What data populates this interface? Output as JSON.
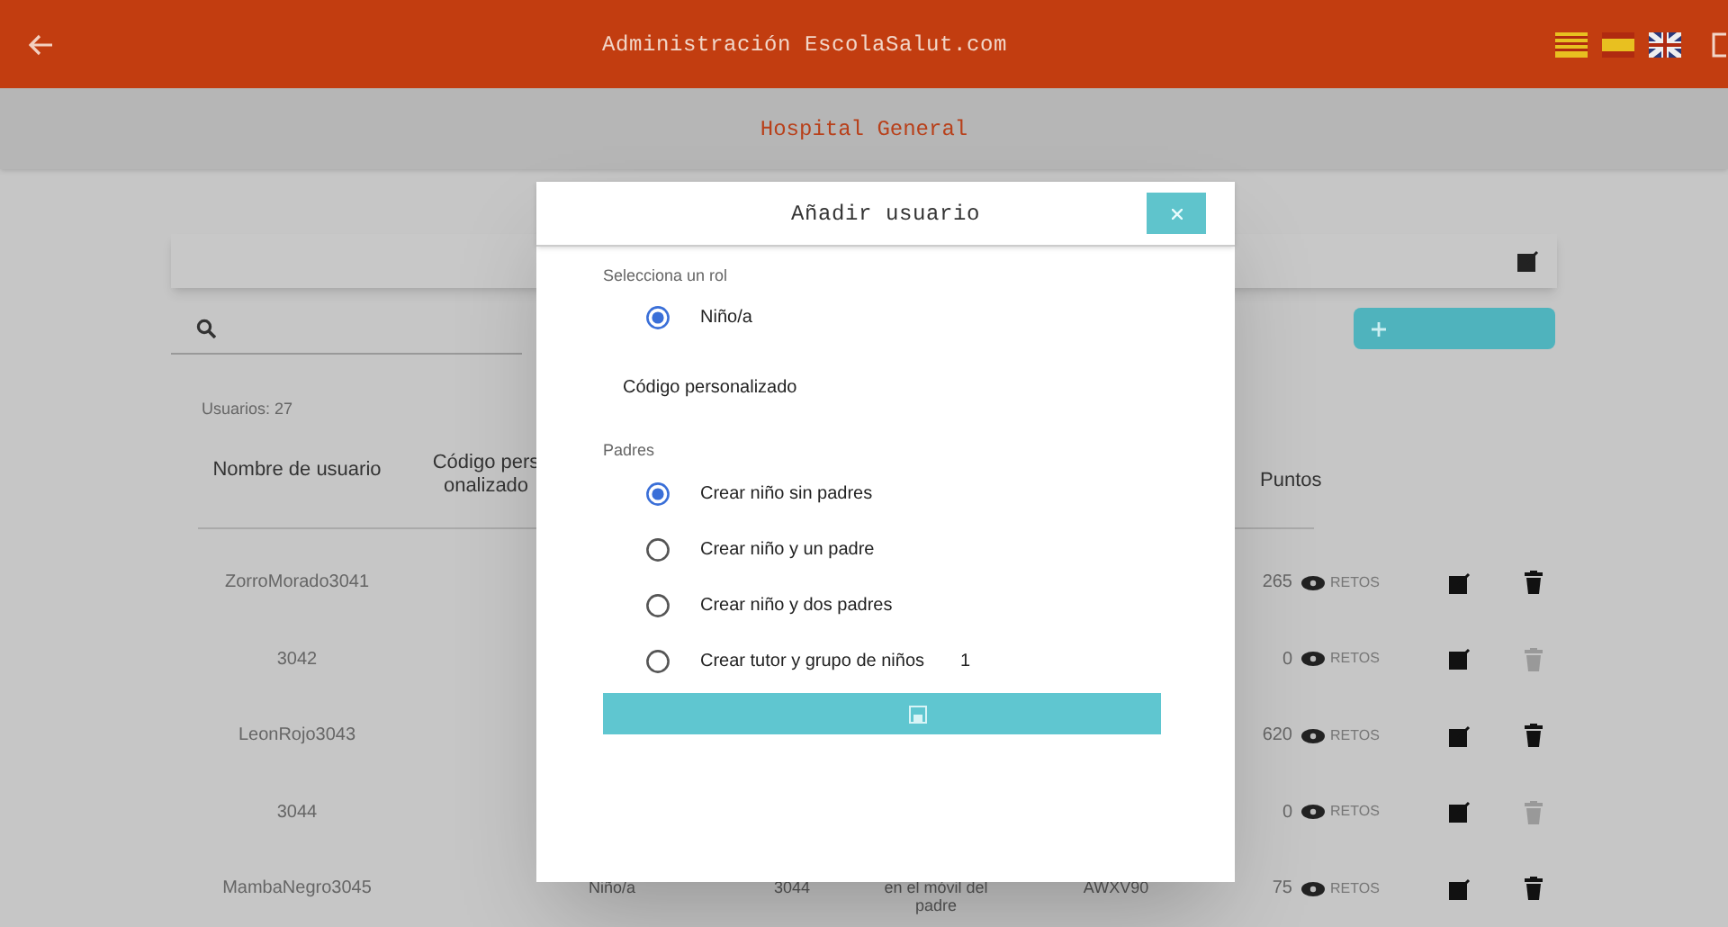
{
  "header": {
    "title": "Administración EscolaSalut.com",
    "flags": [
      {
        "kind": "catalan"
      },
      {
        "kind": "spain"
      },
      {
        "kind": "uk"
      }
    ]
  },
  "subheader": {
    "title": "Hospital General"
  },
  "users_count": "Usuarios: 27",
  "table": {
    "columns": [
      "Nombre de usuario",
      "Código personalizado",
      "Puntos"
    ],
    "rows": [
      {
        "name": "ZorroMorado3041",
        "points": "265",
        "retos": "RETOS",
        "delete_enabled": true
      },
      {
        "name": "3042",
        "points": "0",
        "retos": "RETOS",
        "delete_enabled": false
      },
      {
        "name": "LeonRojo3043",
        "points": "620",
        "retos": "RETOS",
        "delete_enabled": true
      },
      {
        "name": "3044",
        "points": "0",
        "retos": "RETOS",
        "delete_enabled": false
      },
      {
        "name": "MambaNegro3045",
        "points": "75",
        "retos": "RETOS",
        "delete_enabled": true,
        "cells": [
          "Niño/a",
          "3044",
          "en el móvil del padre",
          "AWXV90"
        ]
      }
    ]
  },
  "dialog": {
    "title": "Añadir usuario",
    "role_label": "Selecciona un rol",
    "roles": [
      {
        "label": "Niño/a",
        "selected": true
      }
    ],
    "custom_code_label": "Código personalizado",
    "parents_label": "Padres",
    "parent_options": [
      {
        "label": "Crear niño sin padres",
        "selected": true
      },
      {
        "label": "Crear niño y un padre",
        "selected": false
      },
      {
        "label": "Crear niño y dos padres",
        "selected": false
      },
      {
        "label": "Crear tutor y grupo de niños",
        "selected": false,
        "count": "1"
      }
    ]
  }
}
